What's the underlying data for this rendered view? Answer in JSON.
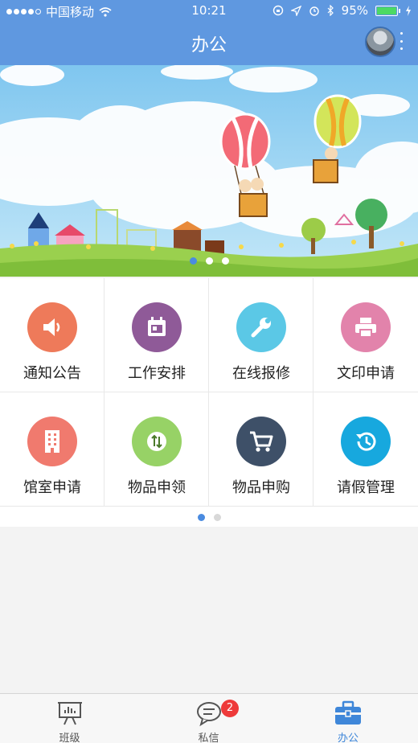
{
  "status_bar": {
    "carrier": "中国移动",
    "time": "10:21",
    "battery": "95%",
    "battery_level": 0.95
  },
  "header": {
    "title": "办公"
  },
  "banner": {
    "slide_count": 3,
    "active_slide": 0
  },
  "grid": {
    "items": [
      {
        "label": "通知公告",
        "icon": "speaker-icon",
        "color": "#ee7a5a"
      },
      {
        "label": "工作安排",
        "icon": "calendar-icon",
        "color": "#8f5a98"
      },
      {
        "label": "在线报修",
        "icon": "wrench-icon",
        "color": "#5bc8e6"
      },
      {
        "label": "文印申请",
        "icon": "printer-icon",
        "color": "#e283ab"
      },
      {
        "label": "馆室申请",
        "icon": "building-icon",
        "color": "#f07a6e"
      },
      {
        "label": "物品申领",
        "icon": "exchange-icon",
        "color": "#97d266"
      },
      {
        "label": "物品申购",
        "icon": "cart-icon",
        "color": "#3e5068"
      },
      {
        "label": "请假管理",
        "icon": "history-icon",
        "color": "#17a8de"
      }
    ],
    "page_count": 2,
    "active_page": 0
  },
  "tabbar": {
    "tabs": [
      {
        "label": "班级",
        "icon": "presentation-board-icon"
      },
      {
        "label": "私信",
        "icon": "chat-bubble-icon",
        "badge": "2"
      },
      {
        "label": "办公",
        "icon": "briefcase-icon",
        "active": true
      }
    ]
  }
}
